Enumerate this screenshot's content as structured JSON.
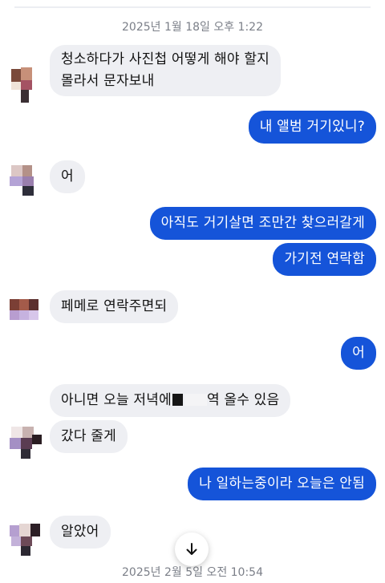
{
  "timestamps": {
    "top": "2025년 1월 18일 오후 1:22",
    "bottom": "2025년 2월 5일 오전 10:54"
  },
  "messages": {
    "m1_line1": "청소하다가 사진첩 어떻게 해야 할지",
    "m1_line2": "몰라서 문자보내",
    "m2": "내 앨범 거기있니?",
    "m3": "어",
    "m4": "아직도 거기살면 조만간 찾으러갈게",
    "m5": "가기전 연락함",
    "m6": "페메로 연락주면되",
    "m7": "어",
    "m8_a": "아니면 오늘 저녁에",
    "m8_b": "역 올수 있음",
    "m9": "갔다 줄게",
    "m10": "나 일하는중이라 오늘은 안됨",
    "m11": "알았어"
  },
  "icons": {
    "scroll_down": "arrow-down-icon"
  },
  "colors": {
    "outgoing_bubble": "#1554d9",
    "incoming_bubble": "#eeeff3",
    "timestamp_text": "#7b7f88"
  }
}
